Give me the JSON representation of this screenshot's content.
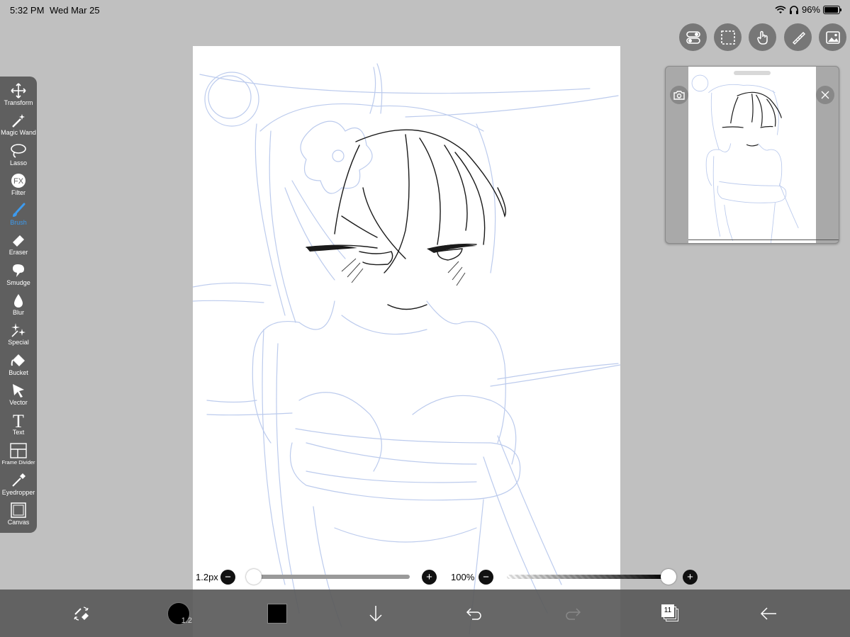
{
  "status": {
    "time": "5:32 PM",
    "date": "Wed Mar 25",
    "battery": "96%",
    "battery_level": 0.96
  },
  "toolbar": {
    "tools": [
      {
        "label": "Transform",
        "icon": "move-arrows-icon"
      },
      {
        "label": "Magic Wand",
        "icon": "magic-wand-icon"
      },
      {
        "label": "Lasso",
        "icon": "lasso-icon"
      },
      {
        "label": "Filter",
        "icon": "fx-icon"
      },
      {
        "label": "Brush",
        "icon": "brush-icon",
        "active": true
      },
      {
        "label": "Eraser",
        "icon": "eraser-icon"
      },
      {
        "label": "Smudge",
        "icon": "smudge-icon"
      },
      {
        "label": "Blur",
        "icon": "droplet-icon"
      },
      {
        "label": "Special",
        "icon": "sparkle-icon"
      },
      {
        "label": "Bucket",
        "icon": "bucket-icon"
      },
      {
        "label": "Vector",
        "icon": "cursor-icon"
      },
      {
        "label": "Text",
        "icon": "text-icon"
      },
      {
        "label": "Frame Divider",
        "icon": "frame-divider-icon"
      },
      {
        "label": "Eyedropper",
        "icon": "eyedropper-icon"
      },
      {
        "label": "Canvas",
        "icon": "canvas-icon"
      }
    ]
  },
  "brush": {
    "size_label": "1.2px",
    "size_value": 0.0,
    "opacity_label": "100%",
    "opacity_value": 1.0
  },
  "bottom": {
    "brush_size_badge": "1.2",
    "layers_count": "11",
    "color": "#000000"
  },
  "colors": {
    "accent": "#3d9bef",
    "toolbar": "#5f5f5f",
    "sketch_blue": "#b8c8ec"
  }
}
